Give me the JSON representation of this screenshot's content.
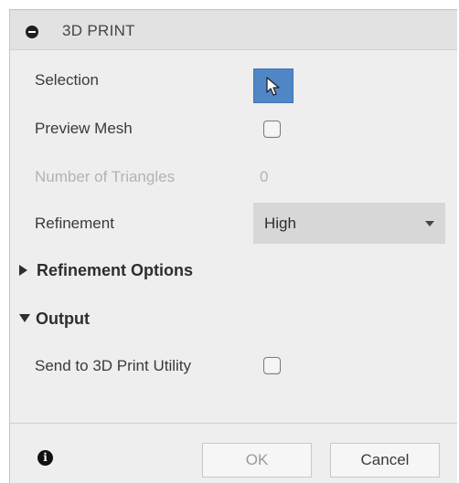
{
  "dialog": {
    "title": "3D PRINT",
    "selection_label": "Selection",
    "preview_mesh_label": "Preview Mesh",
    "preview_mesh_checked": false,
    "num_triangles_label": "Number of Triangles",
    "num_triangles_value": "0",
    "refinement_label": "Refinement",
    "refinement_value": "High",
    "refinement_options_header": "Refinement Options",
    "output_header": "Output",
    "send_to_utility_label": "Send to 3D Print Utility",
    "send_to_utility_checked": false
  },
  "footer": {
    "ok_label": "OK",
    "cancel_label": "Cancel"
  },
  "icons": {
    "title": "collapse-minus-icon",
    "selection": "cursor-arrow-icon",
    "info": "info-icon"
  },
  "colors": {
    "selection_accent": "#4f86c6",
    "panel_bg": "#eeeeee",
    "disabled_text": "#b3b3b3"
  }
}
